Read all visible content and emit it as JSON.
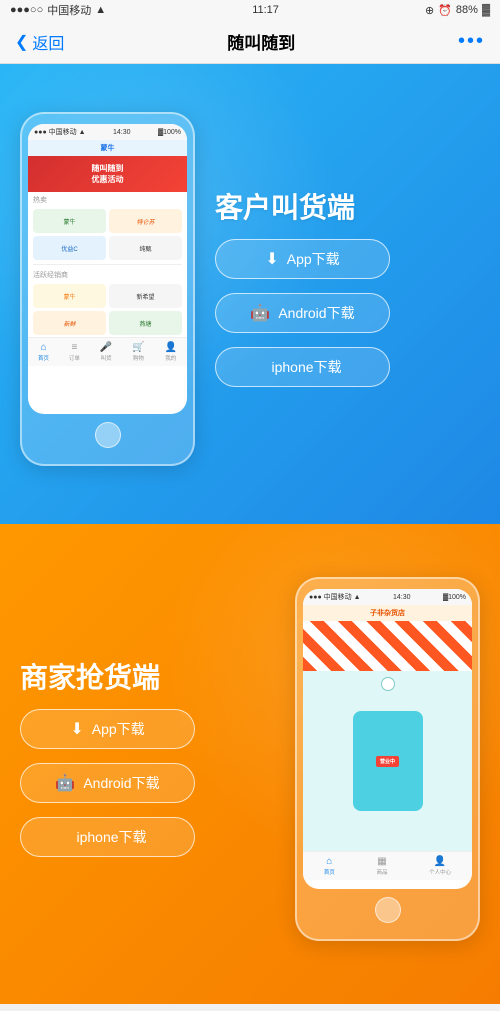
{
  "statusBar": {
    "carrier": "中国移动",
    "wifi": "WiFi",
    "time": "11:17",
    "location": "↑",
    "alarm": "⏰",
    "battery": "88%"
  },
  "navBar": {
    "back": "返回",
    "title": "随叫随到",
    "more": "•••"
  },
  "blueSection": {
    "heading": "客户叫货端",
    "phoneStatus": "中国移动  14:30",
    "phoneBattery": "100%",
    "appTitle": "蒙牛",
    "bannerText": "随叫随到\n优惠活动",
    "hotSaleLabel": "热卖",
    "brandItems": [
      "蒙牛",
      "特仑苏",
      "纯甄"
    ],
    "activeLabel": "活跃经销商",
    "dealerItems": [
      "蒙牛",
      "新希望",
      "燕塘"
    ],
    "navItems": [
      "首页",
      "订单",
      "购物",
      "我的"
    ],
    "btn1": "App下载",
    "btn2": "Android下载",
    "btn3": "iphone下载"
  },
  "orangeSection": {
    "heading": "商家抢货端",
    "phoneStatus": "中国移动  14:30",
    "phoneBattery": "100%",
    "storeTitle": "子非杂货店",
    "statusText": "营业中",
    "navItems": [
      "首页",
      "商品",
      "个人中心"
    ],
    "btn1": "App下载",
    "btn2": "Android下载",
    "btn3": "iphone下载"
  }
}
